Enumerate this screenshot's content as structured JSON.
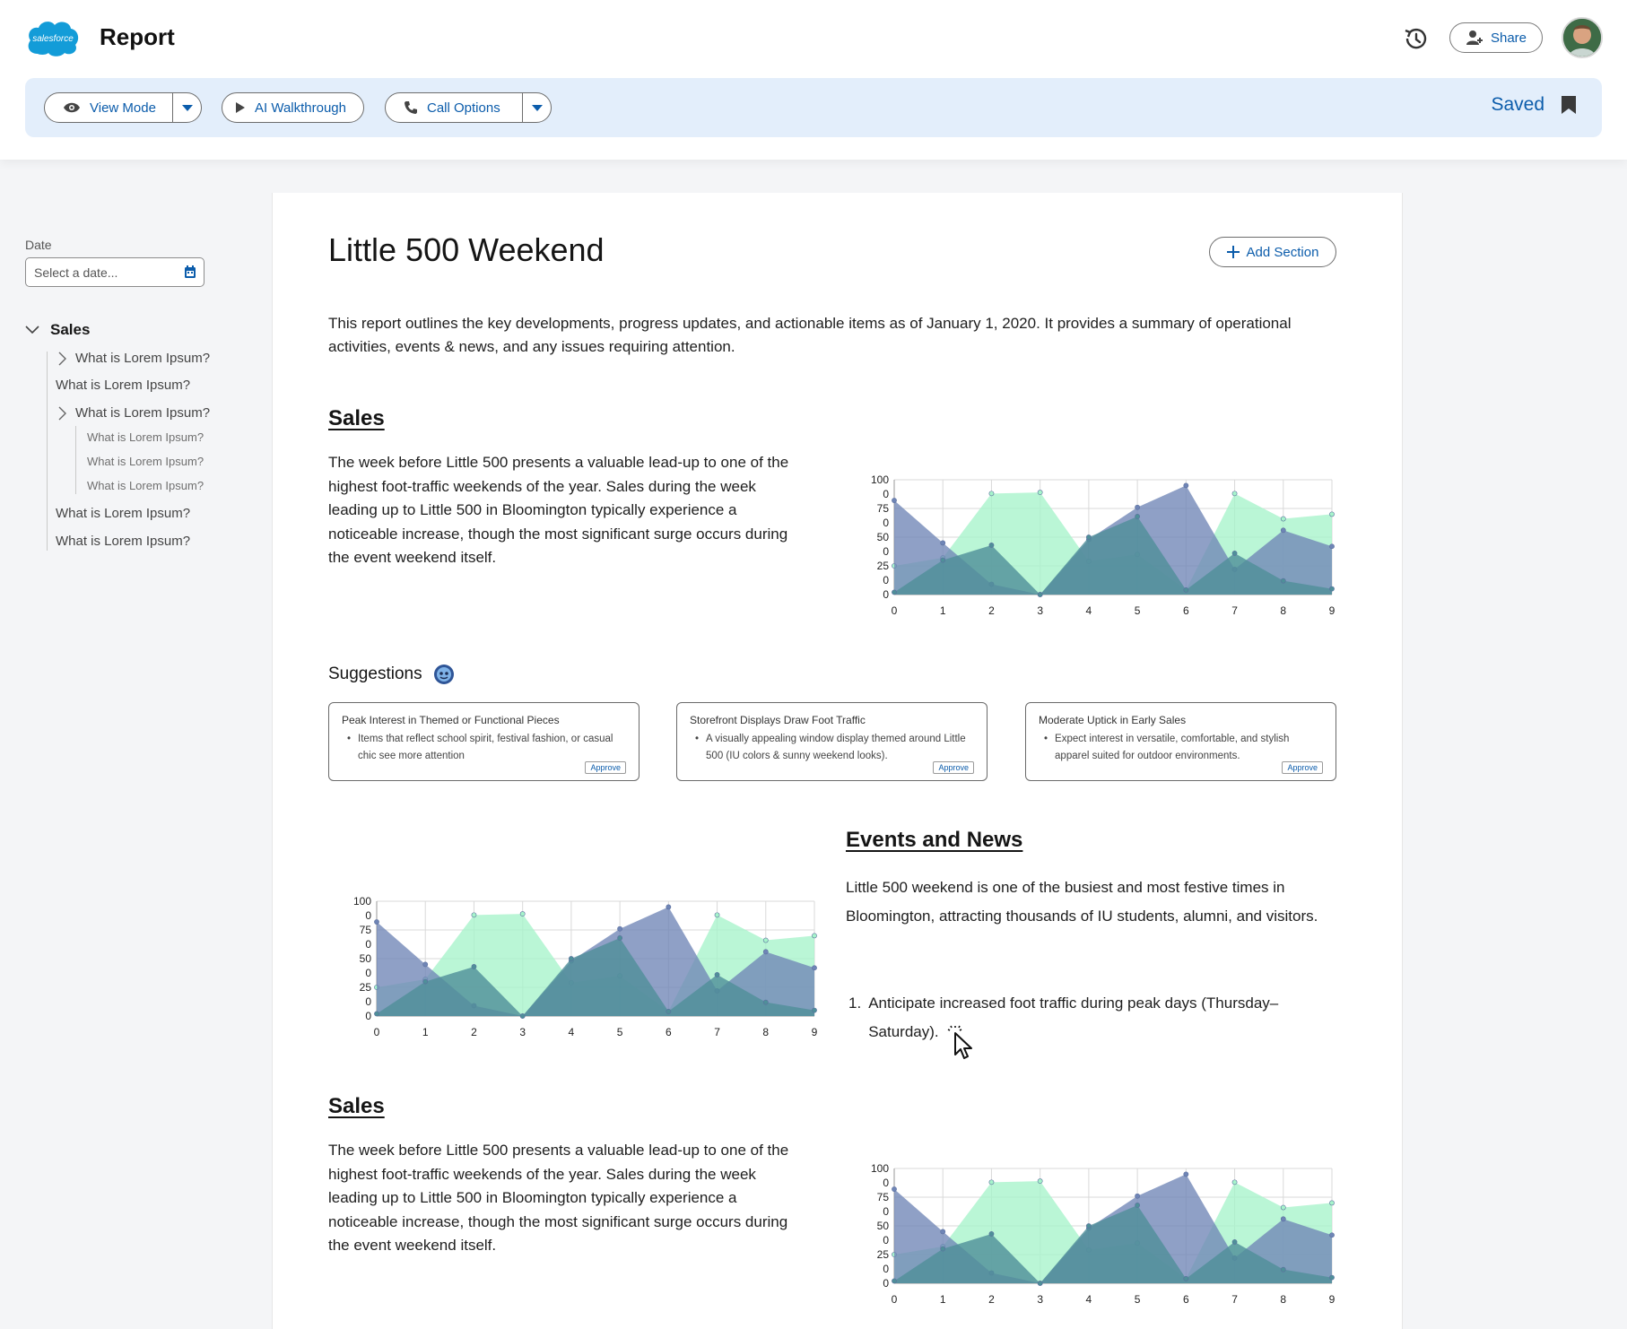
{
  "header": {
    "brand": "salesforce",
    "title": "Report",
    "share_label": "Share"
  },
  "toolbar": {
    "view_mode_label": "View Mode",
    "ai_walkthrough_label": "AI Walkthrough",
    "call_options_label": "Call Options",
    "saved_label": "Saved"
  },
  "sidebar": {
    "date_label": "Date",
    "date_placeholder": "Select a date...",
    "root_label": "Sales",
    "items": [
      {
        "label": "What is Lorem Ipsum?"
      },
      {
        "label": "What is Lorem Ipsum?"
      },
      {
        "label": "What is Lorem Ipsum?"
      },
      {
        "label": "What is Lorem Ipsum?"
      },
      {
        "label": "What is Lorem Ipsum?"
      },
      {
        "label": "What is Lorem Ipsum?"
      },
      {
        "label": "What is Lorem Ipsum?"
      },
      {
        "label": "What is Lorem Ipsum?"
      }
    ]
  },
  "main": {
    "title": "Little 500 Weekend",
    "add_section_label": "Add Section",
    "intro": "This report outlines the key developments, progress updates, and actionable items as of January 1, 2020. It provides a summary of operational activities, events & news, and any issues requiring attention.",
    "sales_heading": "Sales",
    "sales_text": "The week before Little 500 presents a valuable lead-up to one of the highest foot-traffic weekends of the year. Sales during the week leading up to Little 500 in Bloomington typically experience a noticeable increase, though the most significant surge occurs during the event weekend itself.",
    "suggestions_heading": "Suggestions",
    "suggestions": [
      {
        "title": "Peak Interest in Themed or Functional Pieces",
        "bullet": "Items that reflect school spirit, festival fashion, or casual chic see more attention",
        "action": "Approve"
      },
      {
        "title": "Storefront Displays Draw Foot Traffic",
        "bullet": "A visually appealing window display themed around Little 500 (IU colors & sunny weekend looks).",
        "action": "Approve"
      },
      {
        "title": "Moderate Uptick in Early Sales",
        "bullet": "Expect interest in versatile, comfortable, and stylish apparel suited for outdoor environments.",
        "action": "Approve"
      }
    ],
    "events_heading": "Events and News",
    "events_text": "Little 500 weekend is one of the busiest and most festive times in Bloomington, attracting thousands of IU students, alumni, and visitors.",
    "events_list": [
      {
        "num": "1.",
        "text": "Anticipate increased foot traffic during peak days (Thursday–Saturday)."
      }
    ],
    "sales2_heading": "Sales",
    "sales2_text": "The week before Little 500 presents a valuable lead-up to one of the highest foot-traffic weekends of the year. Sales during the week leading up to Little 500 in Bloomington typically experience a noticeable increase, though the most significant surge occurs during the event weekend itself."
  },
  "colors": {
    "accent": "#0b5cab",
    "toolbar_bg": "#e3eefb",
    "series_blue": "#6f85b6",
    "series_green": "#a6f4cb",
    "series_teal": "#4f8f99"
  },
  "chart_data": {
    "type": "area",
    "x": [
      0,
      1,
      2,
      3,
      4,
      5,
      6,
      7,
      8,
      9
    ],
    "ytick_labels": [
      "100",
      "0",
      "75",
      "0",
      "50",
      "0",
      "25",
      "0",
      "0"
    ],
    "series": [
      {
        "values": [
          25,
          32,
          88,
          89,
          29,
          35,
          4,
          88,
          66,
          70
        ],
        "color": "#a6f4cb"
      },
      {
        "values": [
          82,
          45,
          9,
          0,
          48,
          76,
          95,
          22,
          56,
          42
        ],
        "color": "#6f85b6"
      },
      {
        "values": [
          2,
          30,
          43,
          0,
          50,
          68,
          4,
          36,
          12,
          5
        ],
        "color": "#4f8f99"
      }
    ],
    "ylim": [
      0,
      100
    ],
    "grid": true
  }
}
